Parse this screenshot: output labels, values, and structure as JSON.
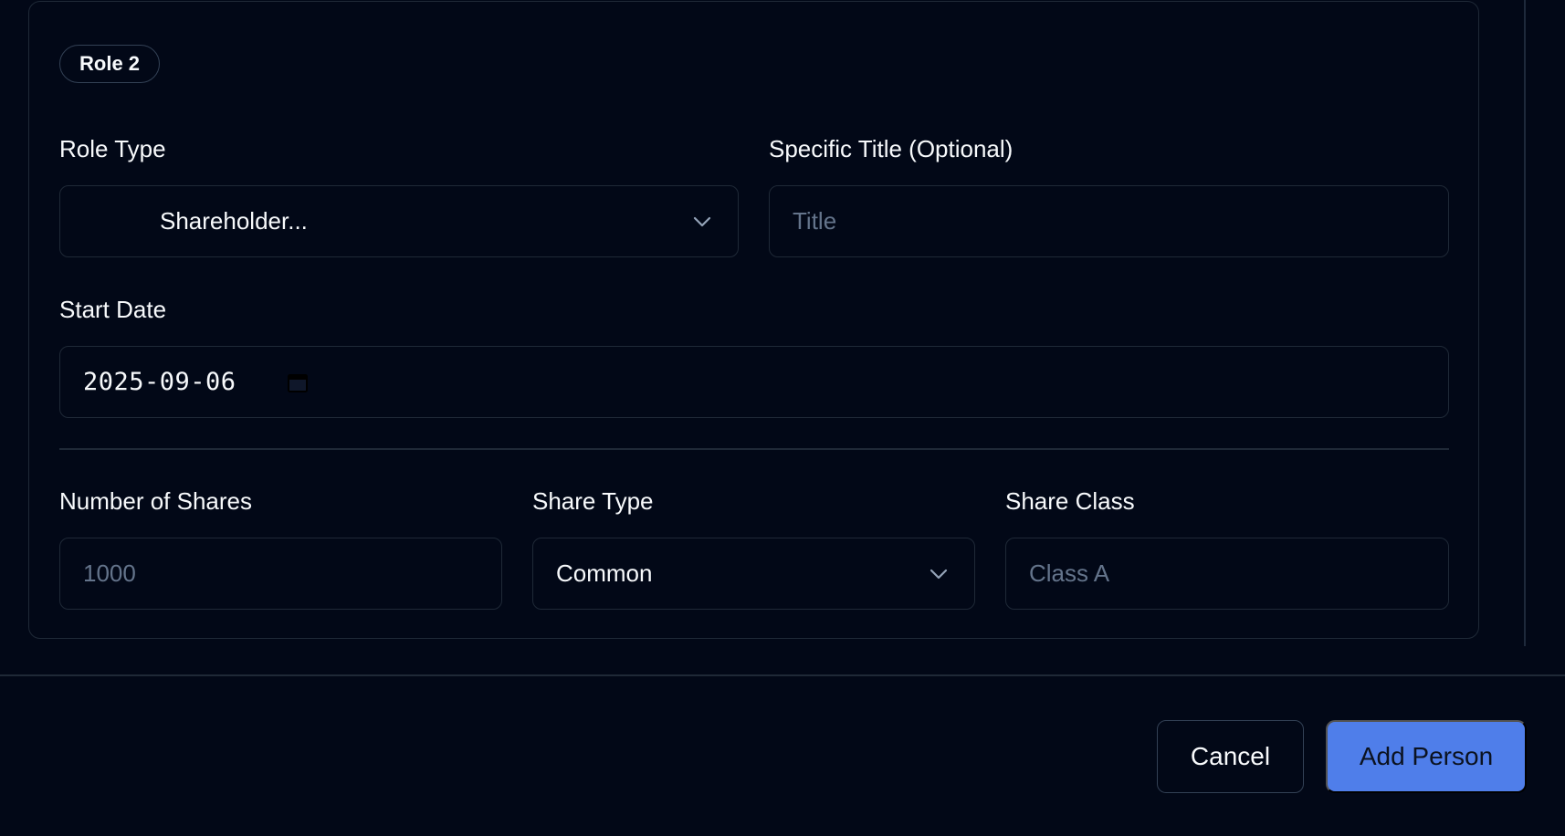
{
  "role": {
    "badge": "Role 2",
    "role_type_label": "Role Type",
    "role_type_value": "Shareholder...",
    "title_label": "Specific Title (Optional)",
    "title_placeholder": "Title",
    "start_date_label": "Start Date",
    "start_date_value": "2025-09-06"
  },
  "shares": {
    "number_label": "Number of Shares",
    "number_placeholder": "1000",
    "type_label": "Share Type",
    "type_value": "Common",
    "class_label": "Share Class",
    "class_placeholder": "Class A"
  },
  "footer": {
    "cancel_label": "Cancel",
    "add_label": "Add Person"
  },
  "colors": {
    "background": "#020817",
    "border": "#1f2937",
    "primary": "#4f7eea",
    "placeholder": "#64748b"
  },
  "icons": [
    "chevron-down-icon",
    "calendar-icon"
  ]
}
